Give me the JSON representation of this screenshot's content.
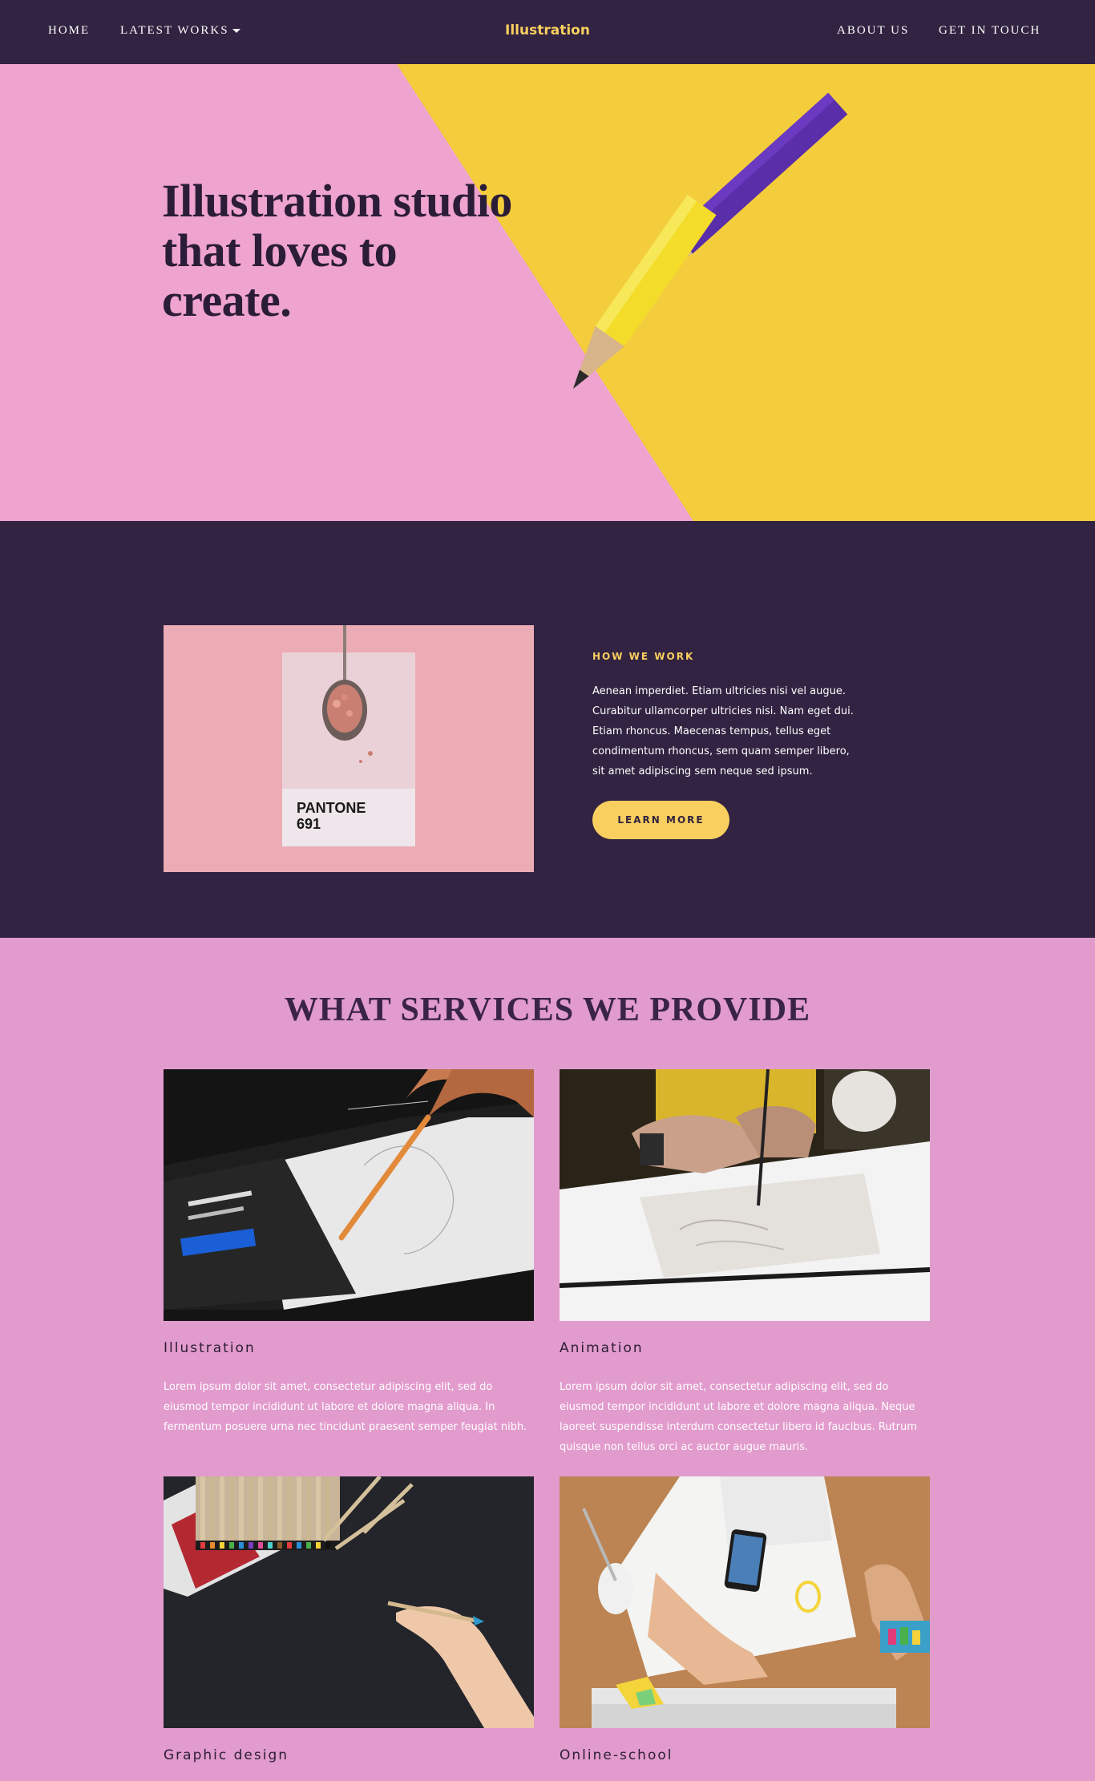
{
  "nav": {
    "home": "HOME",
    "latest_works": "LATEST WORKS",
    "brand": "Illustration",
    "about": "ABOUT US",
    "contact": "GET IN TOUCH"
  },
  "hero": {
    "title": "Illustration studio that loves to create."
  },
  "how_we_work": {
    "eyebrow": "HOW WE WORK",
    "body": "Aenean imperdiet. Etiam ultricies nisi vel augue. Curabitur ullamcorper ultricies nisi. Nam eget dui. Etiam rhoncus. Maecenas tempus, tellus eget condimentum rhoncus, sem quam semper libero, sit amet adipiscing sem neque sed ipsum.",
    "button": "LEARN MORE",
    "image_label_brand": "PANTONE",
    "image_label_code": "691"
  },
  "services": {
    "title": "WHAT SERVICES WE PROVIDE",
    "items": [
      {
        "title": "Illustration",
        "text": "Lorem ipsum dolor sit amet, consectetur adipiscing elit, sed do eiusmod tempor incididunt ut labore et dolore magna aliqua. In fermentum posuere urna nec tincidunt praesent semper feugiat nibh."
      },
      {
        "title": "Animation",
        "text": "Lorem ipsum dolor sit amet, consectetur adipiscing elit, sed do eiusmod tempor incididunt ut labore et dolore magna aliqua. Neque laoreet suspendisse interdum consectetur libero id faucibus. Rutrum quisque non tellus orci ac auctor augue mauris."
      },
      {
        "title": "Graphic design",
        "text": ""
      },
      {
        "title": "Online-school",
        "text": ""
      }
    ]
  },
  "colors": {
    "dark_purple": "#312341",
    "accent_yellow": "#f9cf5f",
    "pink_background": "#e29bcd",
    "hero_pink": "#f0a2cf",
    "hero_yellow": "#f1c631"
  }
}
